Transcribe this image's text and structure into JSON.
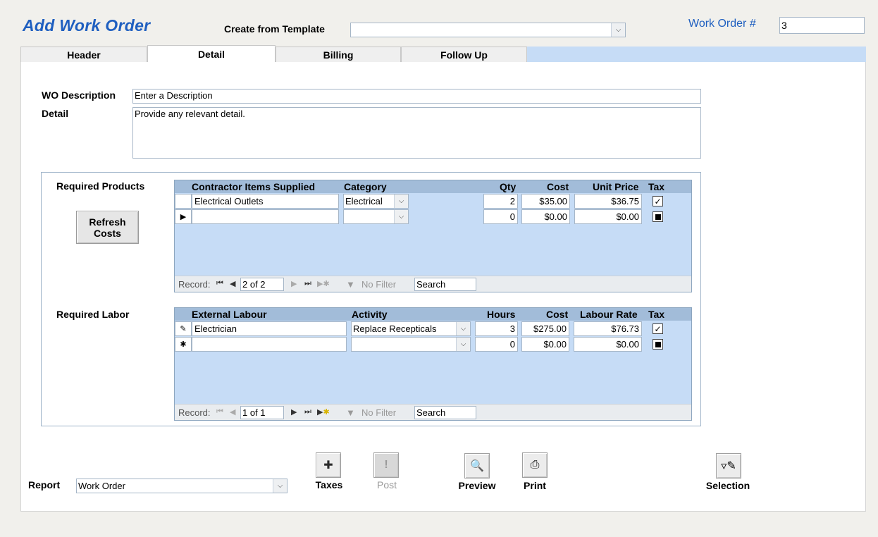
{
  "form": {
    "title": "Add Work Order",
    "template_label": "Create from Template",
    "template_value": "",
    "wo_number_label": "Work Order #",
    "wo_number_value": "3"
  },
  "tabs": [
    "Header",
    "Detail",
    "Billing",
    "Follow Up"
  ],
  "detail": {
    "wo_description_label": "WO Description",
    "wo_description_value": "Enter a Description",
    "detail_label": "Detail",
    "detail_value": "Provide any relevant detail."
  },
  "products": {
    "label": "Required Products",
    "refresh_button": "Refresh\nCosts",
    "columns": [
      "Contractor Items Supplied",
      "Category",
      "Qty",
      "Cost",
      "Unit Price",
      "Tax"
    ],
    "rows": [
      {
        "item": "Electrical Outlets",
        "category": "Electrical",
        "qty": "2",
        "cost": "$35.00",
        "unit_price": "$36.75",
        "tax": "checked"
      },
      {
        "item": "",
        "category": "",
        "qty": "0",
        "cost": "$0.00",
        "unit_price": "$0.00",
        "tax": "indeterminate"
      }
    ],
    "nav": {
      "record_label": "Record:",
      "position": "2 of 2",
      "filter": "No Filter",
      "search": "Search"
    }
  },
  "labor": {
    "label": "Required Labor",
    "columns": [
      "External Labour",
      "Activity",
      "Hours",
      "Cost",
      "Labour Rate",
      "Tax"
    ],
    "rows": [
      {
        "item": "Electrician",
        "activity": "Replace Recepticals",
        "hours": "3",
        "cost": "$275.00",
        "rate": "$76.73",
        "tax": "checked"
      },
      {
        "item": "",
        "activity": "",
        "hours": "0",
        "cost": "$0.00",
        "rate": "$0.00",
        "tax": "indeterminate"
      }
    ],
    "nav": {
      "record_label": "Record:",
      "position": "1 of 1",
      "filter": "No Filter",
      "search": "Search"
    }
  },
  "footer": {
    "report_label": "Report",
    "report_value": "Work Order",
    "buttons": {
      "taxes": "Taxes",
      "post": "Post",
      "preview": "Preview",
      "print": "Print",
      "selection": "Selection"
    }
  },
  "colors": {
    "title_blue": "#1f5fc0",
    "grid_bg": "#c6dcf6",
    "grid_header": "#a2bcd9"
  }
}
